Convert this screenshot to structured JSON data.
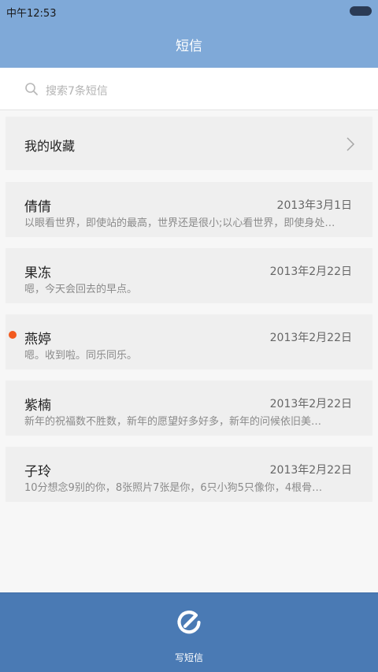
{
  "status_bar": {
    "time": "中午12:53"
  },
  "header": {
    "title": "短信"
  },
  "search": {
    "placeholder": "搜索7条短信"
  },
  "favorites": {
    "label": "我的收藏"
  },
  "messages": [
    {
      "name": "倩倩",
      "date": "2013年3月1日",
      "preview": "以眼看世界，即使站的最高，世界还是很小;以心看世界，即使身处…",
      "unread": false
    },
    {
      "name": "果冻",
      "date": "2013年2月22日",
      "preview": "嗯，今天会回去的早点。",
      "unread": false
    },
    {
      "name": "燕婷",
      "date": "2013年2月22日",
      "preview": "嗯。收到啦。同乐同乐。",
      "unread": true
    },
    {
      "name": "紫楠",
      "date": "2013年2月22日",
      "preview": "新年的祝福数不胜数，新年的愿望好多好多，新年的问候依旧美…",
      "unread": false
    },
    {
      "name": "子玲",
      "date": "2013年2月22日",
      "preview": "10分想念9别的你，8张照片7张是你，6只小狗5只像你，4根骨…",
      "unread": false
    }
  ],
  "bottom_bar": {
    "compose_label": "写短信"
  },
  "colors": {
    "header": "#7fa9d8",
    "bottom_bar": "#4a7ab4",
    "unread_dot": "#f25a1f"
  }
}
